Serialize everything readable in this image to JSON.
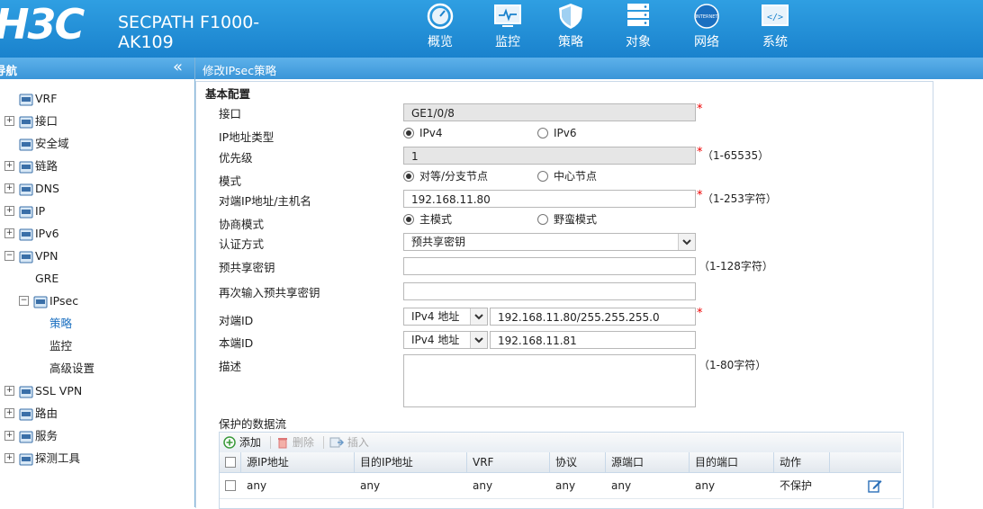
{
  "header": {
    "logo": "H3C",
    "product_line1": "SECPATH F1000-",
    "product_line2": "AK109",
    "nav": [
      {
        "label": "概览",
        "icon": "gauge-icon"
      },
      {
        "label": "监控",
        "icon": "monitor-icon"
      },
      {
        "label": "策略",
        "icon": "shield-icon"
      },
      {
        "label": "对象",
        "icon": "server-icon"
      },
      {
        "label": "网络",
        "icon": "internet-globe-icon",
        "badge": "INTERNET"
      },
      {
        "label": "系统",
        "icon": "code-window-icon"
      }
    ]
  },
  "sidebar": {
    "title": "导航",
    "collapse": "«",
    "items": [
      {
        "label": "VRF",
        "expander": "",
        "icon": "vrf-icon"
      },
      {
        "label": "接口",
        "expander": "+",
        "icon": "interface-icon"
      },
      {
        "label": "安全域",
        "expander": "",
        "icon": "security-zone-icon"
      },
      {
        "label": "链路",
        "expander": "+",
        "icon": "link-icon"
      },
      {
        "label": "DNS",
        "expander": "+",
        "icon": "dns-icon"
      },
      {
        "label": "IP",
        "expander": "+",
        "icon": "ip-icon"
      },
      {
        "label": "IPv6",
        "expander": "+",
        "icon": "ipv6-icon"
      },
      {
        "label": "VPN",
        "expander": "−",
        "icon": "vpn-icon"
      },
      {
        "label": "GRE",
        "expander": "",
        "icon": ""
      },
      {
        "label": "IPsec",
        "expander": "−",
        "icon": "ipsec-icon"
      },
      {
        "label": "策略",
        "expander": "",
        "icon": ""
      },
      {
        "label": "监控",
        "expander": "",
        "icon": ""
      },
      {
        "label": "高级设置",
        "expander": "",
        "icon": ""
      },
      {
        "label": "SSL VPN",
        "expander": "+",
        "icon": "ssl-vpn-icon"
      },
      {
        "label": "路由",
        "expander": "+",
        "icon": "route-icon"
      },
      {
        "label": "服务",
        "expander": "+",
        "icon": "service-icon"
      },
      {
        "label": "探测工具",
        "expander": "+",
        "icon": "probe-tool-icon"
      }
    ]
  },
  "main": {
    "title": "修改IPsec策略",
    "section": "基本配置",
    "form": {
      "interface": {
        "label": "接口",
        "value": "GE1/0/8"
      },
      "ip_type": {
        "label": "IP地址类型",
        "opt1": "IPv4",
        "opt2": "IPv6",
        "selected": "IPv4"
      },
      "priority": {
        "label": "优先级",
        "value": "1",
        "hint": "（1-65535）"
      },
      "mode": {
        "label": "模式",
        "opt1": "对等/分支节点",
        "opt2": "中心节点",
        "selected": "对等/分支节点"
      },
      "peer": {
        "label": "对端IP地址/主机名",
        "value": "192.168.11.80",
        "hint": "（1-253字符）"
      },
      "negotiation": {
        "label": "协商模式",
        "opt1": "主模式",
        "opt2": "野蛮模式",
        "selected": "主模式"
      },
      "auth": {
        "label": "认证方式",
        "value": "预共享密钥"
      },
      "psk": {
        "label": "预共享密钥",
        "value": "",
        "hint": "（1-128字符）"
      },
      "psk_confirm": {
        "label": "再次输入预共享密钥",
        "value": ""
      },
      "peer_id": {
        "label": "对端ID",
        "type": "IPv4 地址",
        "value": "192.168.11.80/255.255.255.0"
      },
      "local_id": {
        "label": "本端ID",
        "type": "IPv4 地址",
        "value": "192.168.11.81"
      },
      "description": {
        "label": "描述",
        "value": "",
        "hint": "（1-80字符）"
      },
      "required_mark": "*"
    },
    "flows": {
      "title": "保护的数据流",
      "toolbar": {
        "add": "添加",
        "delete": "删除",
        "insert": "插入"
      },
      "columns": [
        "源IP地址",
        "目的IP地址",
        "VRF",
        "协议",
        "源端口",
        "目的端口",
        "动作"
      ],
      "rows": [
        {
          "src_ip": "any",
          "dst_ip": "any",
          "vrf": "any",
          "protocol": "any",
          "src_port": "any",
          "dst_port": "any",
          "action": "不保护"
        }
      ]
    }
  },
  "colors": {
    "header_blue": "#1f8bd4",
    "required": "#e00000",
    "active_nav": "#1a6fc0"
  }
}
